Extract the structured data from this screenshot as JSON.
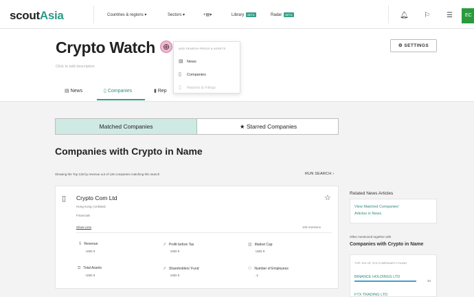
{
  "topbar": {
    "logo_part1": "scout",
    "logo_part2": "Asia",
    "nav": [
      {
        "label": "Countries & regions",
        "suffix": "▾"
      },
      {
        "label": "Sectors",
        "suffix": "▾"
      },
      {
        "label": "+",
        "suffix": "▾"
      },
      {
        "label": "Library",
        "badge": "BETA"
      },
      {
        "label": "Radar",
        "badge": "BETA"
      }
    ],
    "icons": [
      "bell-icon",
      "bookmark-icon",
      "list-icon"
    ],
    "user_initials": "EC"
  },
  "header": {
    "title": "Crypto Watch",
    "description_placeholder": "Click to add description",
    "settings_label": "SETTINGS",
    "tabs": [
      {
        "label": "News",
        "icon": "news-icon"
      },
      {
        "label": "Companies",
        "icon": "companies-icon",
        "active": true
      },
      {
        "label": "Rep",
        "icon": "reports-icon"
      }
    ]
  },
  "add_menu": {
    "heading": "ADD SEARCH FEEDS & ASSETS",
    "items": [
      {
        "label": "News",
        "icon": "news-icon",
        "disabled": false
      },
      {
        "label": "Companies",
        "icon": "companies-icon",
        "disabled": false
      },
      {
        "label": "Reports & Filings",
        "icon": "reports-icon",
        "disabled": true
      }
    ]
  },
  "toggle": {
    "left": "Matched Companies",
    "right": "★ Starred Companies"
  },
  "section": {
    "heading": "Companies with Crypto in Name",
    "info": "Showing the Top 128 by revenue out of 128 companies matching this search",
    "run_search": "RUN SEARCH ›"
  },
  "company": {
    "name": "Crypto Com Ltd",
    "location": "Hong Kong | Unlisted",
    "sector": "Financials",
    "show_less": "Show Less",
    "mentions": "106 mentions",
    "metrics": [
      {
        "label": "Revenue",
        "value": "USD 0"
      },
      {
        "label": "Profit before Tax",
        "value": "USD 0"
      },
      {
        "label": "Market Cap",
        "value": "USD 0"
      },
      {
        "label": "Total Assets",
        "value": "USD 0"
      },
      {
        "label": "Shareholders' Fund",
        "value": "USD 0"
      },
      {
        "label": "Number of Employees",
        "value": "-1"
      }
    ]
  },
  "sidebar": {
    "related_heading": "Related News Articles",
    "related_link_line1": "View Matched Companies'",
    "related_link_line2": "Articles in News",
    "often_label": "Often mentioned together with",
    "often_heading": "Companies with Crypto in Name",
    "found_label": "TOP 100 OF 223 COMPANIES FOUND",
    "top_company": "BINANCE HOLDINGS LTD",
    "top_company_count": "34",
    "next_company": "FTX TRADING LTD"
  },
  "colors": {
    "accent": "#2e9a86",
    "highlight": "#f4b6cf",
    "active_toggle": "#cfe9e3"
  }
}
